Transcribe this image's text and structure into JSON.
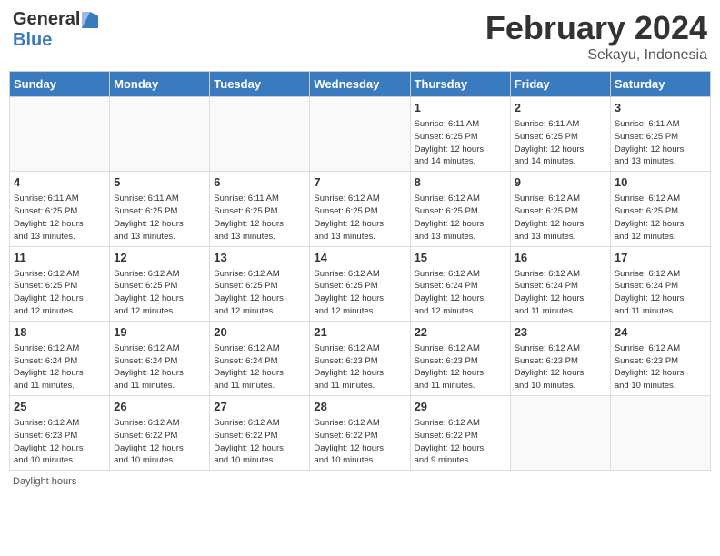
{
  "header": {
    "logo_general": "General",
    "logo_blue": "Blue",
    "month_title": "February 2024",
    "subtitle": "Sekayu, Indonesia"
  },
  "days_of_week": [
    "Sunday",
    "Monday",
    "Tuesday",
    "Wednesday",
    "Thursday",
    "Friday",
    "Saturday"
  ],
  "weeks": [
    [
      {
        "day": "",
        "info": ""
      },
      {
        "day": "",
        "info": ""
      },
      {
        "day": "",
        "info": ""
      },
      {
        "day": "",
        "info": ""
      },
      {
        "day": "1",
        "info": "Sunrise: 6:11 AM\nSunset: 6:25 PM\nDaylight: 12 hours\nand 14 minutes."
      },
      {
        "day": "2",
        "info": "Sunrise: 6:11 AM\nSunset: 6:25 PM\nDaylight: 12 hours\nand 14 minutes."
      },
      {
        "day": "3",
        "info": "Sunrise: 6:11 AM\nSunset: 6:25 PM\nDaylight: 12 hours\nand 13 minutes."
      }
    ],
    [
      {
        "day": "4",
        "info": "Sunrise: 6:11 AM\nSunset: 6:25 PM\nDaylight: 12 hours\nand 13 minutes."
      },
      {
        "day": "5",
        "info": "Sunrise: 6:11 AM\nSunset: 6:25 PM\nDaylight: 12 hours\nand 13 minutes."
      },
      {
        "day": "6",
        "info": "Sunrise: 6:11 AM\nSunset: 6:25 PM\nDaylight: 12 hours\nand 13 minutes."
      },
      {
        "day": "7",
        "info": "Sunrise: 6:12 AM\nSunset: 6:25 PM\nDaylight: 12 hours\nand 13 minutes."
      },
      {
        "day": "8",
        "info": "Sunrise: 6:12 AM\nSunset: 6:25 PM\nDaylight: 12 hours\nand 13 minutes."
      },
      {
        "day": "9",
        "info": "Sunrise: 6:12 AM\nSunset: 6:25 PM\nDaylight: 12 hours\nand 13 minutes."
      },
      {
        "day": "10",
        "info": "Sunrise: 6:12 AM\nSunset: 6:25 PM\nDaylight: 12 hours\nand 12 minutes."
      }
    ],
    [
      {
        "day": "11",
        "info": "Sunrise: 6:12 AM\nSunset: 6:25 PM\nDaylight: 12 hours\nand 12 minutes."
      },
      {
        "day": "12",
        "info": "Sunrise: 6:12 AM\nSunset: 6:25 PM\nDaylight: 12 hours\nand 12 minutes."
      },
      {
        "day": "13",
        "info": "Sunrise: 6:12 AM\nSunset: 6:25 PM\nDaylight: 12 hours\nand 12 minutes."
      },
      {
        "day": "14",
        "info": "Sunrise: 6:12 AM\nSunset: 6:25 PM\nDaylight: 12 hours\nand 12 minutes."
      },
      {
        "day": "15",
        "info": "Sunrise: 6:12 AM\nSunset: 6:24 PM\nDaylight: 12 hours\nand 12 minutes."
      },
      {
        "day": "16",
        "info": "Sunrise: 6:12 AM\nSunset: 6:24 PM\nDaylight: 12 hours\nand 11 minutes."
      },
      {
        "day": "17",
        "info": "Sunrise: 6:12 AM\nSunset: 6:24 PM\nDaylight: 12 hours\nand 11 minutes."
      }
    ],
    [
      {
        "day": "18",
        "info": "Sunrise: 6:12 AM\nSunset: 6:24 PM\nDaylight: 12 hours\nand 11 minutes."
      },
      {
        "day": "19",
        "info": "Sunrise: 6:12 AM\nSunset: 6:24 PM\nDaylight: 12 hours\nand 11 minutes."
      },
      {
        "day": "20",
        "info": "Sunrise: 6:12 AM\nSunset: 6:24 PM\nDaylight: 12 hours\nand 11 minutes."
      },
      {
        "day": "21",
        "info": "Sunrise: 6:12 AM\nSunset: 6:23 PM\nDaylight: 12 hours\nand 11 minutes."
      },
      {
        "day": "22",
        "info": "Sunrise: 6:12 AM\nSunset: 6:23 PM\nDaylight: 12 hours\nand 11 minutes."
      },
      {
        "day": "23",
        "info": "Sunrise: 6:12 AM\nSunset: 6:23 PM\nDaylight: 12 hours\nand 10 minutes."
      },
      {
        "day": "24",
        "info": "Sunrise: 6:12 AM\nSunset: 6:23 PM\nDaylight: 12 hours\nand 10 minutes."
      }
    ],
    [
      {
        "day": "25",
        "info": "Sunrise: 6:12 AM\nSunset: 6:23 PM\nDaylight: 12 hours\nand 10 minutes."
      },
      {
        "day": "26",
        "info": "Sunrise: 6:12 AM\nSunset: 6:22 PM\nDaylight: 12 hours\nand 10 minutes."
      },
      {
        "day": "27",
        "info": "Sunrise: 6:12 AM\nSunset: 6:22 PM\nDaylight: 12 hours\nand 10 minutes."
      },
      {
        "day": "28",
        "info": "Sunrise: 6:12 AM\nSunset: 6:22 PM\nDaylight: 12 hours\nand 10 minutes."
      },
      {
        "day": "29",
        "info": "Sunrise: 6:12 AM\nSunset: 6:22 PM\nDaylight: 12 hours\nand 9 minutes."
      },
      {
        "day": "",
        "info": ""
      },
      {
        "day": "",
        "info": ""
      }
    ]
  ],
  "footer": {
    "daylight_hours": "Daylight hours"
  }
}
